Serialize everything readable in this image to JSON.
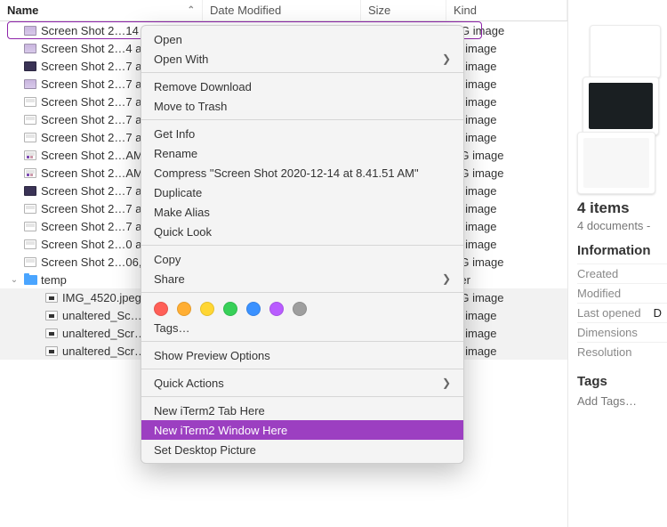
{
  "header": {
    "name": "Name",
    "date": "Date Modified",
    "size": "Size",
    "kind": "Kind"
  },
  "rows": [
    {
      "name": "Screen Shot 2…14 at",
      "kind": "PNG image",
      "icon": "png",
      "selected": true
    },
    {
      "name": "Screen Shot 2…4 at",
      "kind": "NG image",
      "icon": "png"
    },
    {
      "name": "Screen Shot 2…7 at",
      "kind": "NG image",
      "icon": "png-dark"
    },
    {
      "name": "Screen Shot 2…7 at",
      "kind": "NG image",
      "icon": "png"
    },
    {
      "name": "Screen Shot 2…7 at",
      "kind": "NG image",
      "icon": "jpeg"
    },
    {
      "name": "Screen Shot 2…7 at",
      "kind": "NG image",
      "icon": "jpeg"
    },
    {
      "name": "Screen Shot 2…7 at",
      "kind": "NG image",
      "icon": "jpeg"
    },
    {
      "name": "Screen Shot 2…AM",
      "kind": "PEG image",
      "icon": "bars"
    },
    {
      "name": "Screen Shot 2…AM",
      "kind": "PEG image",
      "icon": "bars"
    },
    {
      "name": "Screen Shot 2…7 at",
      "kind": "NG image",
      "icon": "png-dark"
    },
    {
      "name": "Screen Shot 2…7 at",
      "kind": "NG image",
      "icon": "jpeg"
    },
    {
      "name": "Screen Shot 2…7 at",
      "kind": "NG image",
      "icon": "jpeg"
    },
    {
      "name": "Screen Shot 2…0 at",
      "kind": "NG image",
      "icon": "jpeg"
    },
    {
      "name": "Screen Shot 2…06,",
      "kind": "PEG image",
      "icon": "jpeg"
    },
    {
      "name": "temp",
      "kind": "older",
      "icon": "folder",
      "expanded": true
    },
    {
      "name": "IMG_4520.jpeg",
      "kind": "PEG image",
      "icon": "tiny",
      "sub": true,
      "grey": true
    },
    {
      "name": "unaltered_Sc…at",
      "kind": "NG image",
      "icon": "tiny",
      "sub": true,
      "grey": true
    },
    {
      "name": "unaltered_Scr…",
      "kind": "NG image",
      "icon": "tiny",
      "sub": true,
      "grey": true
    },
    {
      "name": "unaltered_Scr…",
      "kind": "NG image",
      "icon": "tiny",
      "sub": true,
      "grey": true
    }
  ],
  "ctx": {
    "open": "Open",
    "open_with": "Open With",
    "remove_download": "Remove Download",
    "move_to_trash": "Move to Trash",
    "get_info": "Get Info",
    "rename": "Rename",
    "compress": "Compress \"Screen Shot 2020-12-14 at 8.41.51 AM\"",
    "duplicate": "Duplicate",
    "make_alias": "Make Alias",
    "quick_look": "Quick Look",
    "copy": "Copy",
    "share": "Share",
    "tags_label": "Tags…",
    "show_preview": "Show Preview Options",
    "quick_actions": "Quick Actions",
    "new_tab": "New iTerm2 Tab Here",
    "new_window": "New iTerm2 Window Here",
    "set_desktop": "Set Desktop Picture",
    "tag_colors": [
      "#ff5f57",
      "#ffae33",
      "#ffd633",
      "#37d058",
      "#3a91ff",
      "#b95cff",
      "#9e9e9e"
    ]
  },
  "sidebar": {
    "count": "4 items",
    "sub": "4 documents -",
    "info": "Information",
    "created": "Created",
    "modified": "Modified",
    "last_opened": "Last opened",
    "last_opened_val": "D",
    "dimensions": "Dimensions",
    "resolution": "Resolution",
    "tags": "Tags",
    "add_tags": "Add Tags…"
  }
}
